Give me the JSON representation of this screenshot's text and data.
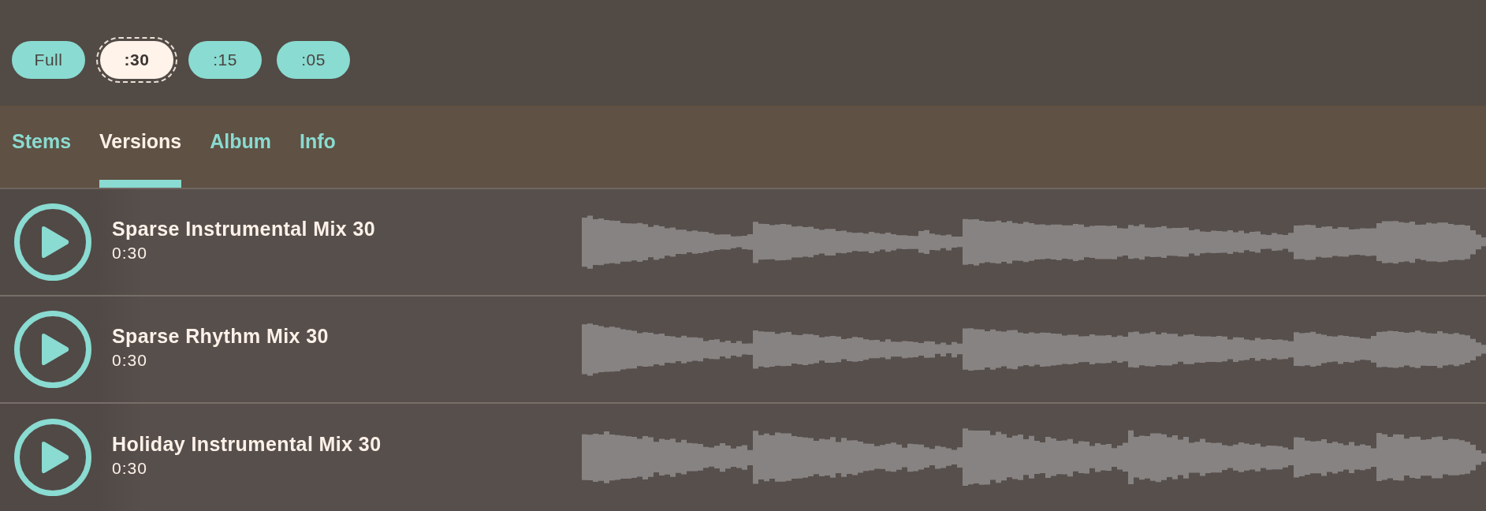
{
  "durations": [
    {
      "label": "Full",
      "selected": false
    },
    {
      "label": ":30",
      "selected": true
    },
    {
      "label": ":15",
      "selected": false
    },
    {
      "label": ":05",
      "selected": false
    }
  ],
  "tabs": [
    {
      "label": "Stems",
      "selected": false
    },
    {
      "label": "Versions",
      "selected": true
    },
    {
      "label": "Album",
      "selected": false
    },
    {
      "label": "Info",
      "selected": false
    }
  ],
  "tracks": [
    {
      "title": "Sparse Instrumental Mix 30",
      "duration": "0:30"
    },
    {
      "title": "Sparse Rhythm Mix 30",
      "duration": "0:30"
    },
    {
      "title": "Holiday Instrumental Mix 30",
      "duration": "0:30"
    }
  ]
}
